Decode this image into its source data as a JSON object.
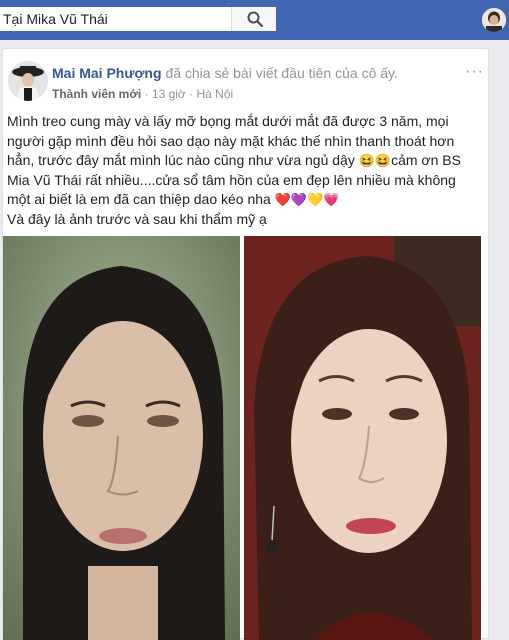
{
  "search": {
    "query": "Tại Mika Vũ Thái"
  },
  "post": {
    "author": "Mai Mai Phượng",
    "action": "đã chia sẻ bài viết đầu tiên của cô ấy.",
    "badge": "Thành viên mới",
    "sep1": "·",
    "time": "13 giờ",
    "sep2": "·",
    "location": "Hà Nội",
    "more": "···",
    "text_line1": "Mình treo cung mày và lấy mỡ bọng mắt dưới mắt đã được 3 năm, mọi người gặp mình đều hỏi sao dạo này mặt khác thế nhìn thanh thoát hơn hẳn, trước đây mắt mình lúc nào cũng như vừa ngủ dậy",
    "emoji1": "😆😆",
    "text_line2": "cảm ơn BS Mia Vũ Thái rất nhiều....cửa sổ tâm hồn của em đẹp lên nhiều mà không một ai biết là em đã can thiệp dao kéo nha",
    "emoji2": "❤️💜💛💗",
    "text_line3": "Và đây là ảnh trước và sau khi thẩm mỹ ạ"
  },
  "colors": {
    "topbar": "#4267b2",
    "link": "#385898",
    "meta": "#90949c"
  },
  "icons": [
    "search-icon",
    "more-options-icon",
    "globe-icon"
  ]
}
